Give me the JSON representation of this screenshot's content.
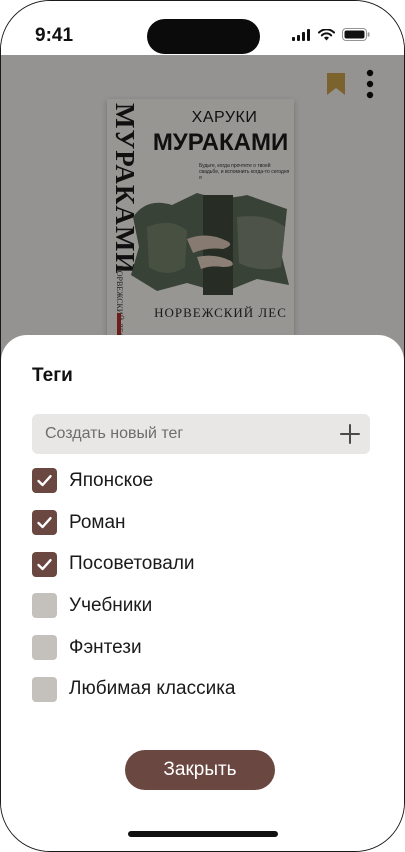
{
  "status_bar": {
    "time": "9:41"
  },
  "book": {
    "author_first": "ХАРУКИ",
    "author_last": "МУРАКАМИ",
    "spine_title": "МУРАКАМИ",
    "spine_subtitle": "НОРВЕЖСКИЙ ЛЕС",
    "tagline": "Будьте, когда прочтете о твоей свадьбе, и вспомнить когда-то сегодня я",
    "title": "НОРВЕЖСКИЙ ЛЕС"
  },
  "sheet": {
    "title": "Теги",
    "new_tag_placeholder": "Создать новый тег",
    "tags": [
      {
        "label": "Японское",
        "checked": true
      },
      {
        "label": "Роман",
        "checked": true
      },
      {
        "label": "Посоветовали",
        "checked": true
      },
      {
        "label": "Учебники",
        "checked": false
      },
      {
        "label": "Фэнтези",
        "checked": false
      },
      {
        "label": "Любимая классика",
        "checked": false
      }
    ],
    "close_label": "Закрыть"
  },
  "icons": {
    "bookmark": "bookmark-icon",
    "more": "more-vertical-icon",
    "add": "plus-icon",
    "check": "check-icon"
  },
  "colors": {
    "accent": "#6a4740",
    "bookmark": "#c9a04a",
    "checkbox_off": "#c4c0bb",
    "input_bg": "#e8e7e6"
  }
}
